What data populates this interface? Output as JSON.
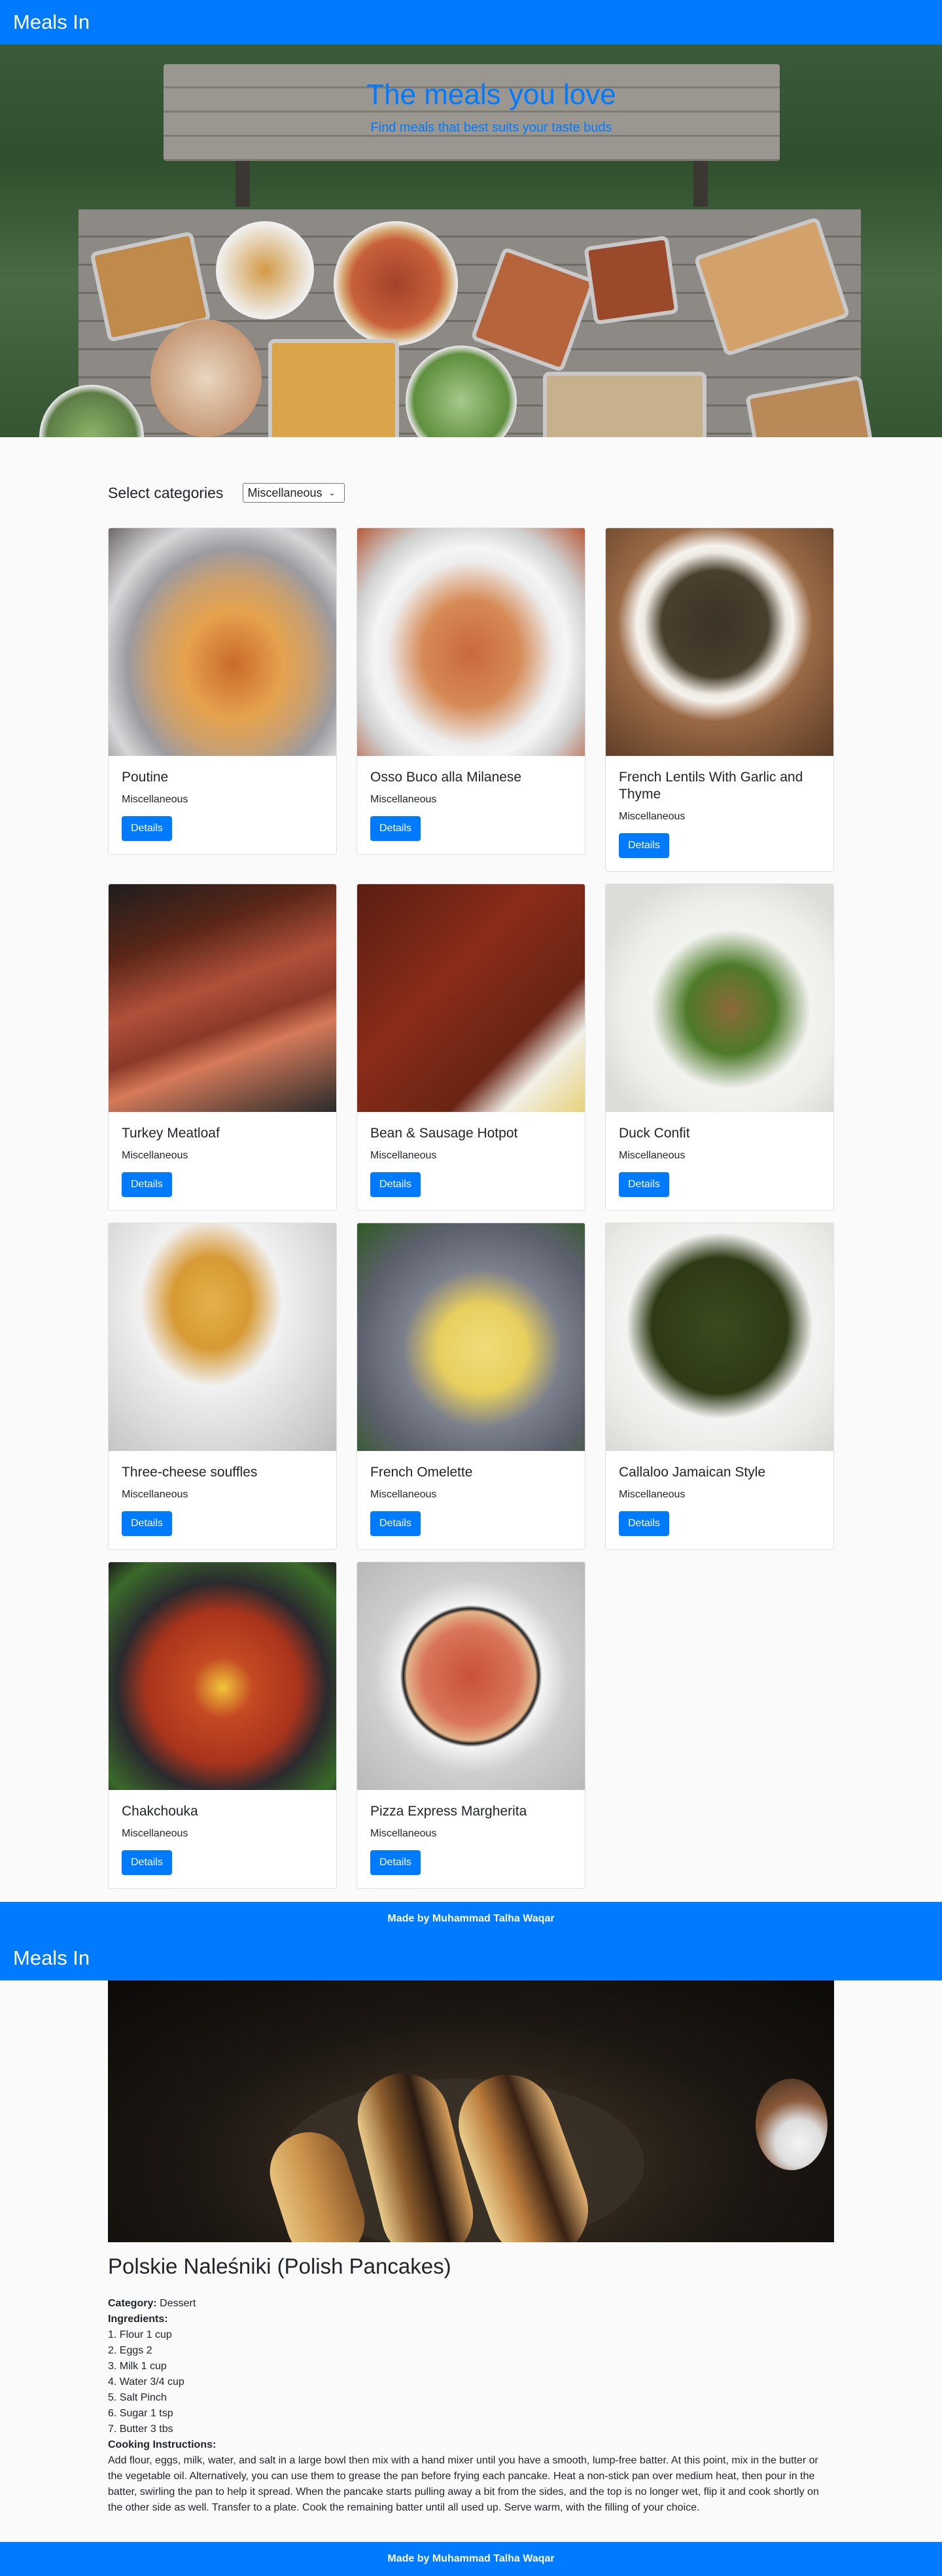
{
  "navbar": {
    "brand": "Meals In"
  },
  "hero": {
    "title": "The meals you love",
    "subtitle": "Find meals that best suits your taste buds"
  },
  "filter": {
    "label": "Select categories",
    "selected": "Miscellaneous"
  },
  "meals": [
    {
      "name": "Poutine",
      "category": "Miscellaneous",
      "button": "Details"
    },
    {
      "name": "Osso Buco alla Milanese",
      "category": "Miscellaneous",
      "button": "Details"
    },
    {
      "name": "French Lentils With Garlic and Thyme",
      "category": "Miscellaneous",
      "button": "Details"
    },
    {
      "name": "Turkey Meatloaf",
      "category": "Miscellaneous",
      "button": "Details"
    },
    {
      "name": "Bean & Sausage Hotpot",
      "category": "Miscellaneous",
      "button": "Details"
    },
    {
      "name": "Duck Confit",
      "category": "Miscellaneous",
      "button": "Details"
    },
    {
      "name": "Three-cheese souffles",
      "category": "Miscellaneous",
      "button": "Details"
    },
    {
      "name": "French Omelette",
      "category": "Miscellaneous",
      "button": "Details"
    },
    {
      "name": "Callaloo Jamaican Style",
      "category": "Miscellaneous",
      "button": "Details"
    },
    {
      "name": "Chakchouka",
      "category": "Miscellaneous",
      "button": "Details"
    },
    {
      "name": "Pizza Express Margherita",
      "category": "Miscellaneous",
      "button": "Details"
    }
  ],
  "footer": {
    "text": "Made by Muhammad Talha Waqar"
  },
  "detail": {
    "title": "Polskie Naleśniki (Polish Pancakes)",
    "category_label": "Category:",
    "category": "Dessert",
    "ingredients_label": "Ingredients:",
    "ingredients": [
      "1. Flour 1 cup",
      "2. Eggs 2",
      "3. Milk 1 cup",
      "4. Water 3/4 cup",
      "5. Salt Pinch",
      "6. Sugar 1 tsp",
      "7. Butter 3 tbs"
    ],
    "instructions_label": "Cooking Instructions:",
    "instructions": "Add flour, eggs, milk, water, and salt in a large bowl then mix with a hand mixer until you have a smooth, lump-free batter. At this point, mix in the butter or the vegetable oil. Alternatively, you can use them to grease the pan before frying each pancake. Heat a non-stick pan over medium heat, then pour in the batter, swirling the pan to help it spread. When the pancake starts pulling away a bit from the sides, and the top is no longer wet, flip it and cook shortly on the other side as well. Transfer to a plate. Cook the remaining batter until all used up. Serve warm, with the filling of your choice."
  }
}
